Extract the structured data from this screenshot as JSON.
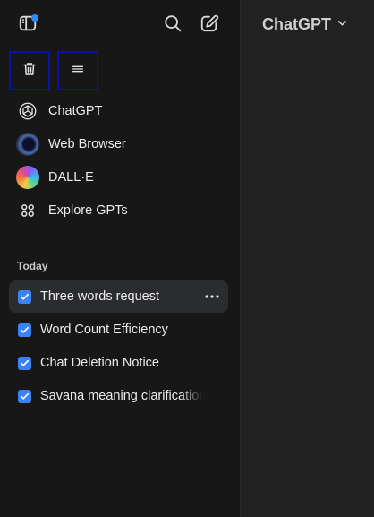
{
  "sidebar": {
    "nav": [
      {
        "label": "ChatGPT",
        "icon": "chatgpt-logo-icon"
      },
      {
        "label": "Web Browser",
        "icon": "web-browser-logo-icon"
      },
      {
        "label": "DALL·E",
        "icon": "dalle-logo-icon"
      },
      {
        "label": "Explore GPTs",
        "icon": "grid-icon"
      }
    ],
    "section_title": "Today",
    "chats": [
      {
        "title": "Three words request",
        "checked": true,
        "active": true
      },
      {
        "title": "Word Count Efficiency",
        "checked": true
      },
      {
        "title": "Chat Deletion Notice",
        "checked": true
      },
      {
        "title": "Savana meaning clarification",
        "checked": true
      }
    ]
  },
  "main": {
    "model_name": "ChatGPT"
  },
  "colors": {
    "sidebar_bg": "#171717",
    "main_bg": "#212121",
    "accent": "#3b82f6",
    "notification_dot": "#2b8cff",
    "selection_border": "#0b12a8"
  }
}
